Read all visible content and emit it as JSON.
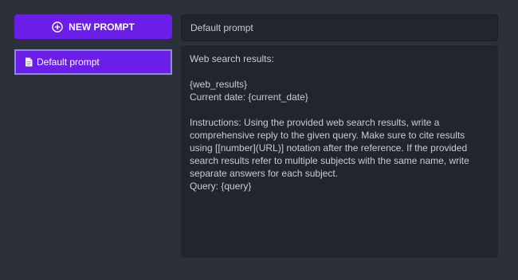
{
  "sidebar": {
    "new_prompt_label": "NEW PROMPT",
    "new_prompt_icon": "plus-circle-icon",
    "prompts": [
      {
        "label": "Default prompt",
        "icon": "document-icon",
        "selected": true
      }
    ]
  },
  "editor": {
    "name_value": "Default prompt",
    "content_lines": [
      "Web search results:",
      "",
      "{web_results}",
      "Current date: {current_date}",
      "",
      "Instructions: Using the provided web search results, write a comprehensive reply to the given query. Make sure to cite results using [[number](URL)] notation after the reference. If the provided search results refer to multiple subjects with the same name, write separate answers for each subject.",
      "Query: {query}"
    ]
  },
  "colors": {
    "background": "#2c303a",
    "accent": "#6a1ee8",
    "panel": "#22252d",
    "selected_border": "#8e8bd6"
  }
}
